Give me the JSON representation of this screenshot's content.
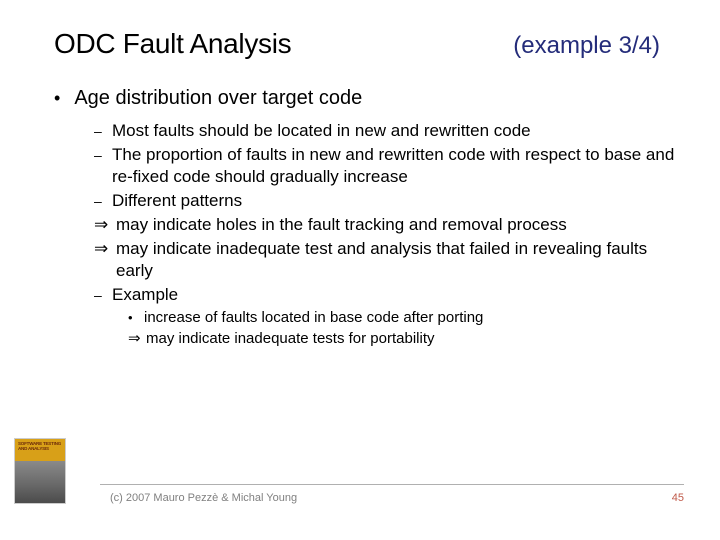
{
  "title": "ODC Fault Analysis",
  "subtitle": "(example 3/4)",
  "main_bullet": "Age distribution over target code",
  "sub": {
    "b1": "Most faults should be located in new and rewritten code",
    "b2": "The proportion of faults in new and rewritten code with respect to base and re-fixed code should gradually increase",
    "b3": "Different patterns",
    "a1": "may indicate holes in the fault tracking and removal process",
    "a2": "may indicate  inadequate test and analysis that failed in revealing faults early",
    "b4": "Example",
    "ex1": "increase of faults located in base code after porting",
    "ex2": "may indicate inadequate tests for portability"
  },
  "footer": {
    "copyright": "(c) 2007 Mauro Pezzè & Michal Young",
    "page": "45",
    "book": "SOFTWARE TESTING AND ANALYSIS"
  }
}
